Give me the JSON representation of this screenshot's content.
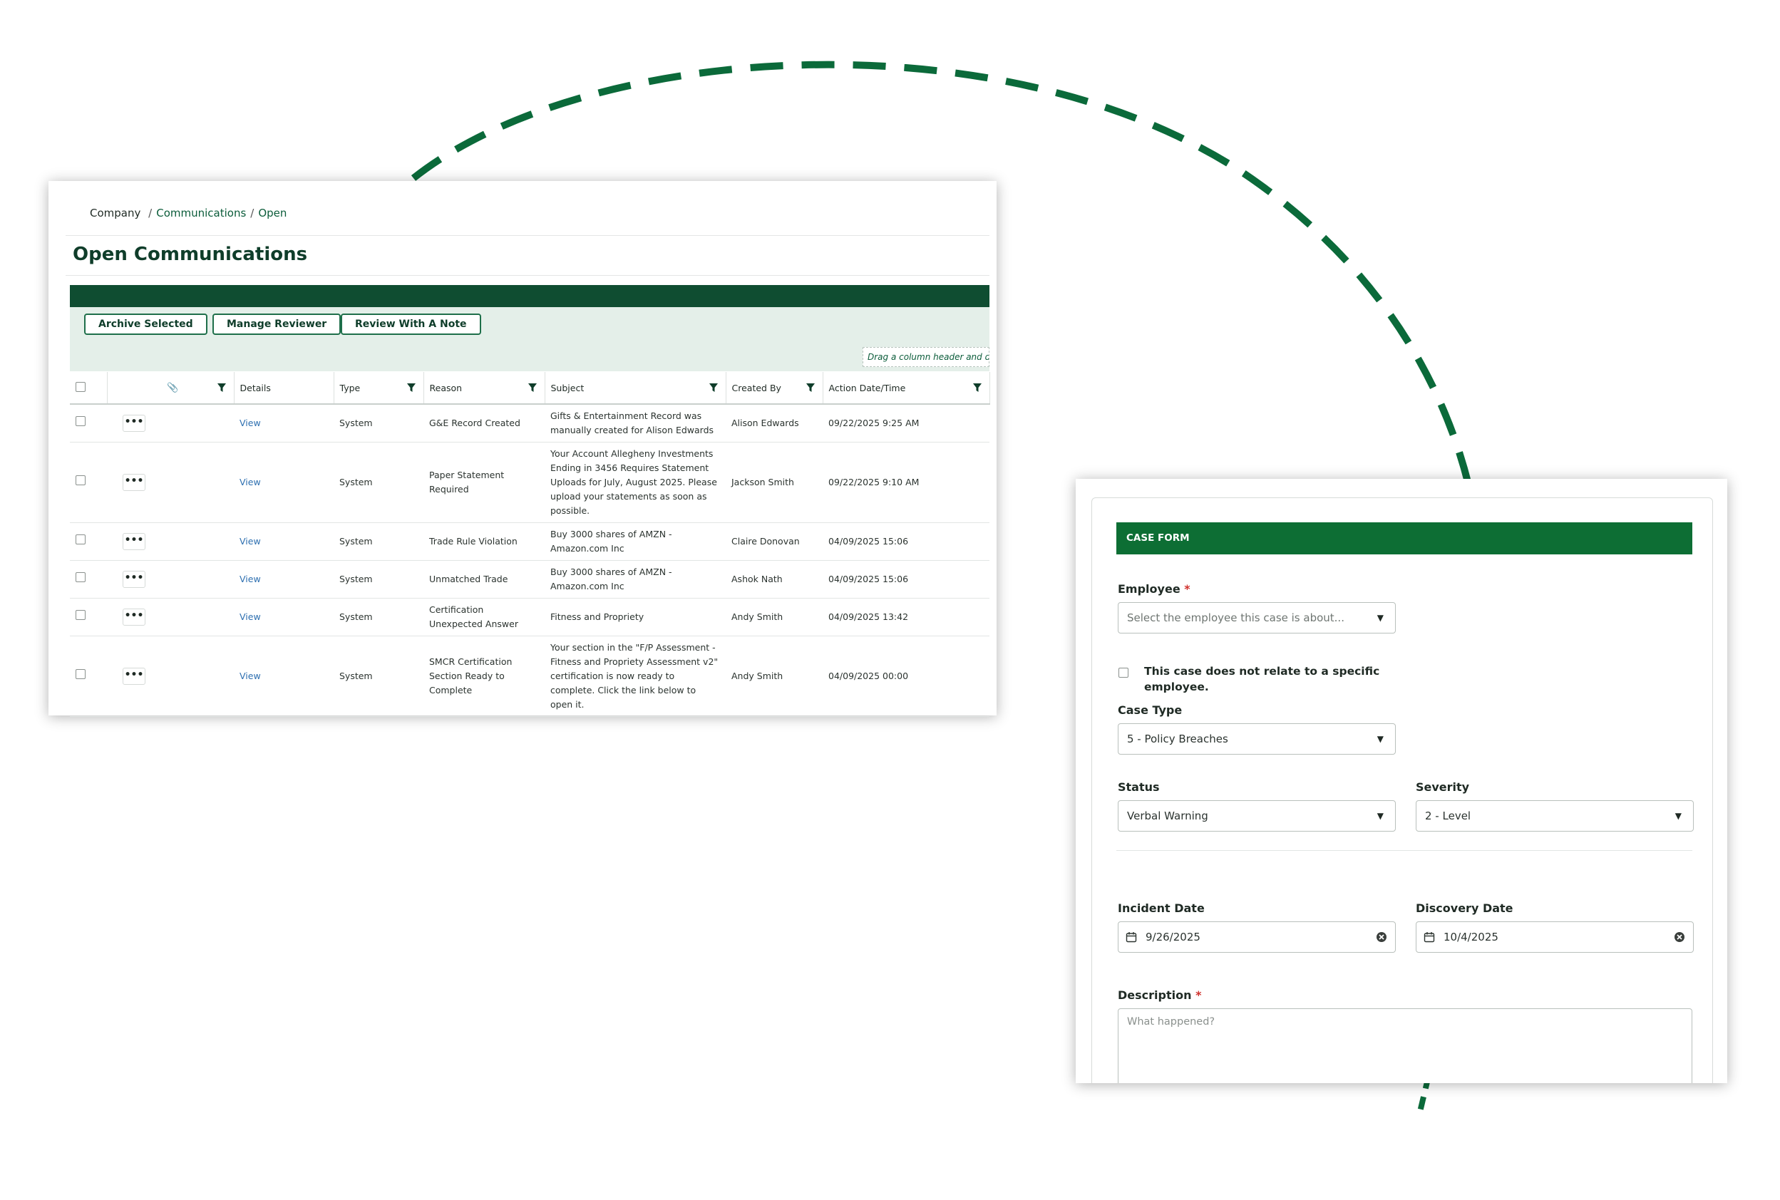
{
  "communications": {
    "breadcrumb": {
      "root": "Company",
      "sep1": "/",
      "mid": "Communications",
      "sep2": "/",
      "current": "Open"
    },
    "title": "Open Communications",
    "toolbar": {
      "archive_label": "Archive Selected",
      "manage_label": "Manage Reviewer",
      "review_label": "Review With A Note",
      "drag_hint": "Drag a column header and drop it here to group by that column"
    },
    "columns": {
      "details": "Details",
      "type": "Type",
      "reason": "Reason",
      "subject": "Subject",
      "created_by": "Created By",
      "action_datetime": "Action Date/Time"
    },
    "rows": [
      {
        "actions": "•••",
        "details": "View",
        "type": "System",
        "reason": "G&E Record Created",
        "subject": "Gifts & Entertainment Record was manually created for Alison Edwards",
        "created_by": "Alison Edwards",
        "datetime": "09/22/2025 9:25 AM"
      },
      {
        "actions": "•••",
        "details": "View",
        "type": "System",
        "reason": "Paper Statement Required",
        "subject": "Your Account Allegheny Investments Ending in 3456 Requires Statement Uploads for July, August 2025. Please upload your statements as soon as possible.",
        "created_by": "Jackson Smith",
        "datetime": "09/22/2025 9:10 AM"
      },
      {
        "actions": "•••",
        "details": "View",
        "type": "System",
        "reason": "Trade Rule Violation",
        "subject": "Buy 3000 shares of AMZN - Amazon.com Inc",
        "created_by": "Claire Donovan",
        "datetime": "04/09/2025 15:06"
      },
      {
        "actions": "•••",
        "details": "View",
        "type": "System",
        "reason": "Unmatched Trade",
        "subject": "Buy 3000 shares of AMZN - Amazon.com Inc",
        "created_by": "Ashok Nath",
        "datetime": "04/09/2025 15:06"
      },
      {
        "actions": "•••",
        "details": "View",
        "type": "System",
        "reason": "Certification Unexpected Answer",
        "subject": "Fitness and Propriety",
        "created_by": "Andy Smith",
        "datetime": "04/09/2025 13:42"
      },
      {
        "actions": "•••",
        "details": "View",
        "type": "System",
        "reason": "SMCR Certification Section Ready to Complete",
        "subject": "Your section in the \"F/P Assessment - Fitness and Propriety Assessment v2\" certification is now ready to complete. Click the link below to open it.",
        "created_by": "Andy Smith",
        "datetime": "04/09/2025 00:00"
      }
    ]
  },
  "case_form": {
    "header": "CASE FORM",
    "employee": {
      "label": "Employee",
      "required": "*",
      "placeholder": "Select the employee this case is about..."
    },
    "no_employee_text": "This case does not relate to a specific employee.",
    "case_type": {
      "label": "Case Type",
      "value": "5 - Policy Breaches"
    },
    "status": {
      "label": "Status",
      "value": "Verbal Warning"
    },
    "severity": {
      "label": "Severity",
      "value": "2 - Level"
    },
    "incident_date": {
      "label": "Incident Date",
      "value": "9/26/2025"
    },
    "discovery_date": {
      "label": "Discovery Date",
      "value": "10/4/2025"
    },
    "description": {
      "label": "Description",
      "required": "*",
      "placeholder": "What happened?"
    },
    "caret": "▼"
  },
  "colors": {
    "brand_dark": "#0f4d31",
    "brand_green": "#0d6e34",
    "toolbar_bg": "#e4efe9",
    "link_blue": "#2d6fb0",
    "required_red": "#d0312d",
    "arc_dash": "#0b6a3a"
  },
  "icons": {
    "filter": "filter-icon",
    "attachment": "paperclip-icon",
    "calendar": "calendar-icon",
    "clear": "clear-circle-icon",
    "dropdown": "chevron-down-icon"
  }
}
